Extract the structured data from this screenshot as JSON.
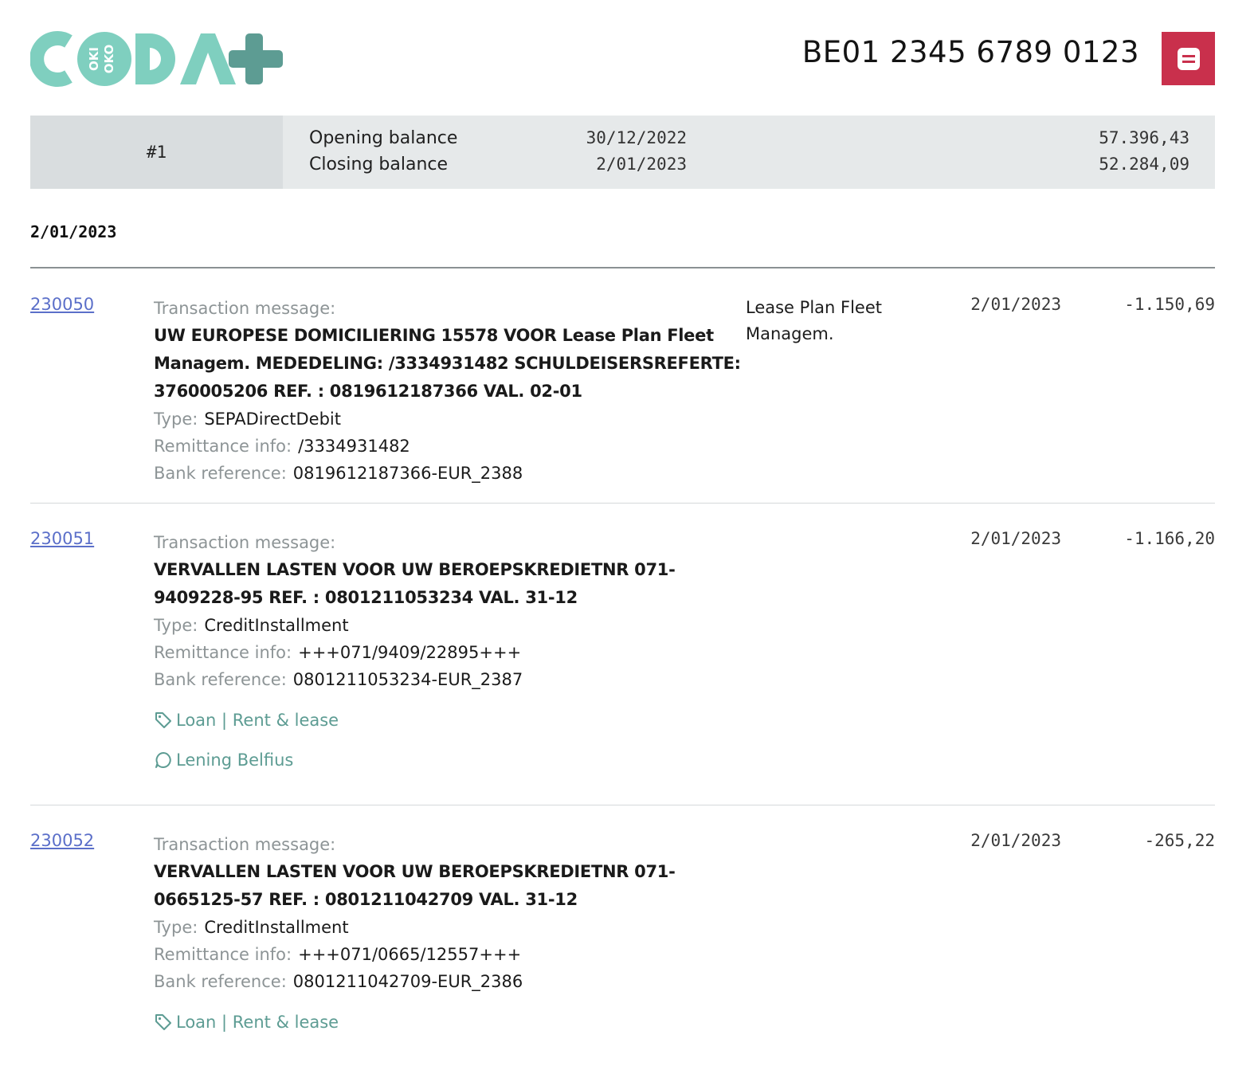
{
  "header": {
    "logo_text": "CODA+",
    "logo_badge_text": "OKI OKO",
    "account_iban": "BE01 2345 6789 0123",
    "menu_icon": "menu-icon"
  },
  "colors": {
    "brand_teal": "#7fcfbf",
    "brand_dark_teal": "#5d9c93",
    "accent_red": "#c9304c",
    "link_blue": "#5b6fc9"
  },
  "balance": {
    "statement_number": "#1",
    "opening_label": "Opening balance",
    "opening_date": "30/12/2022",
    "opening_amount": "57.396,43",
    "closing_label": "Closing balance",
    "closing_date": "2/01/2023",
    "closing_amount": "52.284,09"
  },
  "day": {
    "date": "2/01/2023"
  },
  "labels": {
    "transaction_message": "Transaction message:",
    "type": "Type:",
    "remittance_info": "Remittance info:",
    "bank_reference": "Bank reference:"
  },
  "transactions": [
    {
      "id": "230050",
      "message": "UW EUROPESE DOMICILIERING 15578 VOOR Lease Plan Fleet Managem. MEDEDELING: /3334931482 SCHULDEISERSREFERTE: 3760005206 REF. : 0819612187366 VAL. 02-01",
      "type": "SEPADirectDebit",
      "remittance_info": "/3334931482",
      "bank_reference": "0819612187366-EUR_2388",
      "counterparty": "Lease Plan Fleet Managem.",
      "date": "2/01/2023",
      "amount": "-1.150,69"
    },
    {
      "id": "230051",
      "message": "VERVALLEN LASTEN VOOR UW BEROEPSKREDIETNR 071-9409228-95 REF. : 0801211053234 VAL. 31-12",
      "type": "CreditInstallment",
      "remittance_info": "+++071/9409/22895+++",
      "bank_reference": "0801211053234-EUR_2387",
      "category": "Loan | Rent & lease",
      "note": "Lening Belfius",
      "date": "2/01/2023",
      "amount": "-1.166,20"
    },
    {
      "id": "230052",
      "message": "VERVALLEN LASTEN VOOR UW BEROEPSKREDIETNR 071-0665125-57 REF. : 0801211042709 VAL. 31-12",
      "type": "CreditInstallment",
      "remittance_info": "+++071/0665/12557+++",
      "bank_reference": "0801211042709-EUR_2386",
      "category": "Loan | Rent & lease",
      "date": "2/01/2023",
      "amount": "-265,22"
    }
  ]
}
